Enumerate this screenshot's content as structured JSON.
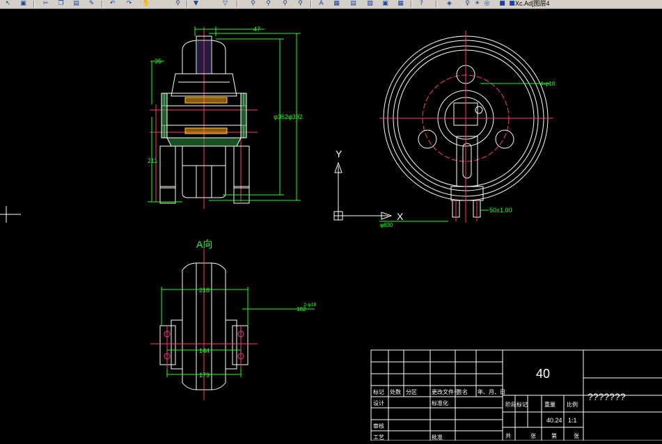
{
  "toolbar": {
    "icons": [
      "select-icon",
      "save-icon",
      "cut-icon",
      "copy-icon",
      "paste-icon",
      "match-icon",
      "undo-icon",
      "redo-icon",
      "pan-icon",
      "zoom-icon",
      "zoom-window-icon",
      "zoom-previous-icon",
      "properties-icon",
      "text-style-icon",
      "dim-style-icon",
      "table-icon",
      "help-icon",
      "layer-icon",
      "bulb-icon",
      "sun-icon",
      "lock-icon",
      "color-icon"
    ],
    "layer_text": "Xc.Ad[图层4"
  },
  "drawing": {
    "dim_47": "47",
    "dim_35": "35",
    "dim_211": "211",
    "dim_dia": "φ362φ392",
    "dim_218": "218",
    "dim_144": "144",
    "dim_179": "179",
    "dim_182": "182",
    "dim_side_small": "2-φ18",
    "dim_50": "50±1.00",
    "dim_630": "φ630",
    "dim_top_right": "4-φ18",
    "view_label": "A向",
    "axis_y": "Y",
    "axis_x": "X"
  },
  "title_block": {
    "drawing_number": "40",
    "part_name": "???????",
    "scale": "1:1",
    "weight": "40.24",
    "cells": [
      "标记",
      "处数",
      "分区",
      "更改文件号",
      "签名",
      "年、月、日",
      "设计",
      "审核",
      "工艺",
      "批准",
      "标准化",
      "阶段标记",
      "重量",
      "比例",
      "共",
      "张",
      "第",
      "张"
    ]
  }
}
